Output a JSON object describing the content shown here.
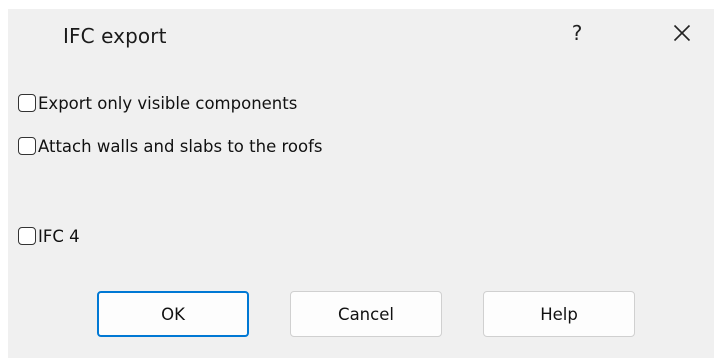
{
  "window": {
    "title": "IFC export",
    "help_glyph": "?",
    "close_icon": "close-icon"
  },
  "options": [
    {
      "label": "Export only visible components",
      "checked": false
    },
    {
      "label": "Attach walls and slabs to the roofs",
      "checked": false
    },
    {
      "label": "IFC 4",
      "checked": false
    }
  ],
  "buttons": {
    "ok_label": "OK",
    "cancel_label": "Cancel",
    "help_label": "Help"
  },
  "colors": {
    "dialog_background": "#f0f0f0",
    "default_button_border": "#0078d4"
  }
}
